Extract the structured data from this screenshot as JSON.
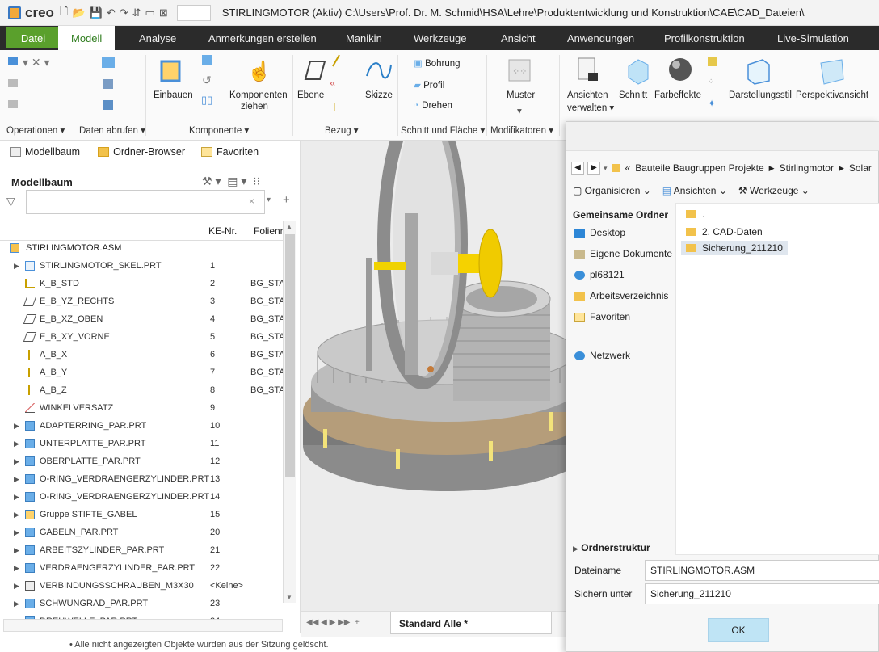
{
  "titlebar": {
    "app_name": "creo",
    "window_title": "STIRLINGMOTOR (Aktiv) C:\\Users\\Prof. Dr. M. Schmid\\HSA\\Lehre\\Produktentwicklung und Konstruktion\\CAE\\CAD_Dateien\\"
  },
  "menu": {
    "items": [
      "Datei",
      "Modell",
      "Analyse",
      "Anmerkungen erstellen",
      "Manikin",
      "Werkzeuge",
      "Ansicht",
      "Anwendungen",
      "Profilkonstruktion",
      "Live-Simulation"
    ],
    "active": "Modell"
  },
  "ribbon": {
    "einbauen": "Einbauen",
    "komponenten_ziehen_1": "Komponenten",
    "komponenten_ziehen_2": "ziehen",
    "ebene": "Ebene",
    "skizze": "Skizze",
    "bohrung": "Bohrung",
    "profil": "Profil",
    "drehen": "Drehen",
    "muster": "Muster",
    "ansichten_verwalten_1": "Ansichten",
    "ansichten_verwalten_2": "verwalten",
    "schnitt": "Schnitt",
    "farbeffekte": "Farbeffekte",
    "darstellungsstil": "Darstellungsstil",
    "perspektivansicht": "Perspektivansicht",
    "groups": {
      "operationen": "Operationen",
      "daten_abrufen": "Daten abrufen",
      "komponente": "Komponente",
      "bezug": "Bezug",
      "schnitt_flaeche": "Schnitt und Fläche",
      "modifikatoren": "Modifikatoren"
    }
  },
  "tree_panel": {
    "tabs": [
      "Modellbaum",
      "Ordner-Browser",
      "Favoriten"
    ],
    "title": "Modellbaum",
    "col_ke": "KE-Nr.",
    "col_folie": "Folienname",
    "root": "STIRLINGMOTOR.ASM",
    "rows": [
      {
        "name": "STIRLINGMOTOR_SKEL.PRT",
        "ke": "1",
        "folie": "",
        "expand": true,
        "icon": "skeleton"
      },
      {
        "name": "K_B_STD",
        "ke": "2",
        "folie": "BG_START",
        "expand": false,
        "icon": "csys"
      },
      {
        "name": "E_B_YZ_RECHTS",
        "ke": "3",
        "folie": "BG_START",
        "expand": false,
        "icon": "plane"
      },
      {
        "name": "E_B_XZ_OBEN",
        "ke": "4",
        "folie": "BG_START",
        "expand": false,
        "icon": "plane"
      },
      {
        "name": "E_B_XY_VORNE",
        "ke": "5",
        "folie": "BG_START",
        "expand": false,
        "icon": "plane"
      },
      {
        "name": "A_B_X",
        "ke": "6",
        "folie": "BG_START",
        "expand": false,
        "icon": "axis"
      },
      {
        "name": "A_B_Y",
        "ke": "7",
        "folie": "BG_START",
        "expand": false,
        "icon": "axis"
      },
      {
        "name": "A_B_Z",
        "ke": "8",
        "folie": "BG_START",
        "expand": false,
        "icon": "axis"
      },
      {
        "name": "WINKELVERSATZ",
        "ke": "9",
        "folie": "",
        "expand": false,
        "icon": "angle"
      },
      {
        "name": "ADAPTERRING_PAR.PRT",
        "ke": "10",
        "folie": "",
        "expand": true,
        "icon": "part"
      },
      {
        "name": "UNTERPLATTE_PAR.PRT",
        "ke": "11",
        "folie": "",
        "expand": true,
        "icon": "part"
      },
      {
        "name": "OBERPLATTE_PAR.PRT",
        "ke": "12",
        "folie": "",
        "expand": true,
        "icon": "part"
      },
      {
        "name": "O-RING_VERDRAENGERZYLINDER.PRT",
        "ke": "13",
        "folie": "",
        "expand": true,
        "icon": "part"
      },
      {
        "name": "O-RING_VERDRAENGERZYLINDER.PRT",
        "ke": "14",
        "folie": "",
        "expand": true,
        "icon": "part"
      },
      {
        "name": "Gruppe STIFTE_GABEL",
        "ke": "15",
        "folie": "",
        "expand": true,
        "icon": "group"
      },
      {
        "name": "GABELN_PAR.PRT",
        "ke": "20",
        "folie": "",
        "expand": true,
        "icon": "part"
      },
      {
        "name": "ARBEITSZYLINDER_PAR.PRT",
        "ke": "21",
        "folie": "",
        "expand": true,
        "icon": "part"
      },
      {
        "name": "VERDRAENGERZYLINDER_PAR.PRT",
        "ke": "22",
        "folie": "",
        "expand": true,
        "icon": "part"
      },
      {
        "name": "VERBINDUNGSSCHRAUBEN_M3X30",
        "ke": "<Keine>",
        "folie": "",
        "expand": true,
        "icon": "pattern"
      },
      {
        "name": "SCHWUNGRAD_PAR.PRT",
        "ke": "23",
        "folie": "",
        "expand": true,
        "icon": "part"
      },
      {
        "name": "DREHWELLE_PAR.PRT",
        "ke": "24",
        "folie": "",
        "expand": true,
        "icon": "part"
      }
    ]
  },
  "viewport": {
    "tab_label": "Standard Alle *"
  },
  "dialog": {
    "path": [
      "Bauteile Baugruppen Projekte",
      "Stirlingmotor",
      "Solar"
    ],
    "toolbar": [
      "Organisieren",
      "Ansichten",
      "Werkzeuge"
    ],
    "sidebar_header": "Gemeinsame Ordner",
    "sidebar_items": [
      "Desktop",
      "Eigene Dokumente",
      "pl68121",
      "Arbeitsverzeichnis",
      "Favoriten",
      "Netzwerk"
    ],
    "folders": [
      ".",
      "2. CAD-Daten",
      "Sicherung_211210"
    ],
    "selected_folder": "Sicherung_211210",
    "folder_structure": "Ordnerstruktur",
    "filename_label": "Dateiname",
    "filename_value": "STIRLINGMOTOR.ASM",
    "save_under_label": "Sichern unter",
    "save_under_value": "Sicherung_211210",
    "ok": "OK"
  },
  "status": "• Alle nicht angezeigten Objekte wurden aus der Sitzung gelöscht."
}
